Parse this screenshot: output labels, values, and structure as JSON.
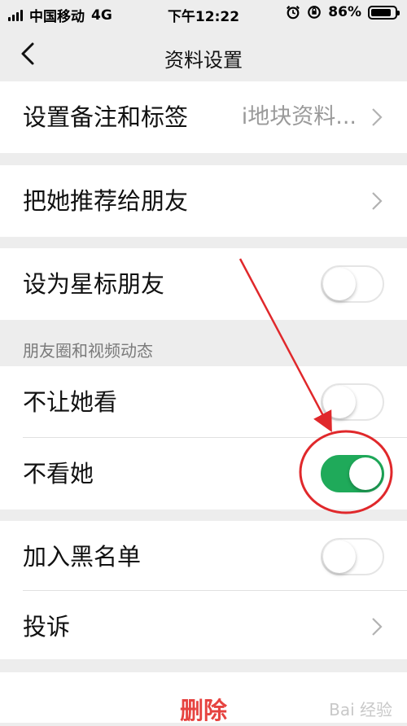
{
  "status_bar": {
    "carrier": "中国移动",
    "network": "4G",
    "time": "下午12:22",
    "battery": "86%",
    "battery_level": 0.86
  },
  "nav": {
    "title": "资料设置",
    "back_icon": "chevron-left-icon"
  },
  "group1": {
    "remark_label": "设置备注和标签",
    "remark_value": "i地块资料..."
  },
  "group2": {
    "recommend_label": "把她推荐给朋友"
  },
  "group3": {
    "star_label": "设为星标朋友",
    "star_on": false
  },
  "moments": {
    "header": "朋友圈和视频动态",
    "hide_mine_label": "不让她看",
    "hide_mine_on": false,
    "hide_hers_label": "不看她",
    "hide_hers_on": true
  },
  "group5": {
    "blacklist_label": "加入黑名单",
    "blacklist_on": false,
    "report_label": "投诉"
  },
  "actions": {
    "delete_label": "删除"
  },
  "watermark": "Bai 经验",
  "colors": {
    "toggle_on": "#1faa5a",
    "delete": "#e64340",
    "annotation": "#e0282b"
  }
}
